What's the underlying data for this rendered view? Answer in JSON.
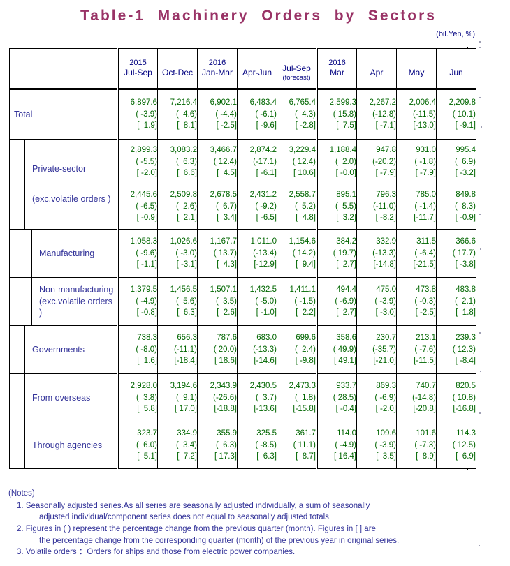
{
  "title": "Table-1  Machinery  Orders  by  Sectors",
  "unit_label": "(bil.Yen, %)",
  "header": {
    "label_col": "",
    "columns": [
      {
        "year": "2015",
        "period": "Jul-Sep",
        "note": ""
      },
      {
        "year": "",
        "period": "Oct-Dec",
        "note": ""
      },
      {
        "year": "2016",
        "period": "Jan-Mar",
        "note": ""
      },
      {
        "year": "",
        "period": "Apr-Jun",
        "note": ""
      },
      {
        "year": "",
        "period": "Jul-Sep",
        "note": "(forecast)"
      },
      {
        "year": "2016",
        "period": "Mar",
        "note": ""
      },
      {
        "year": "",
        "period": "Apr",
        "note": ""
      },
      {
        "year": "",
        "period": "May",
        "note": ""
      },
      {
        "year": "",
        "period": "Jun",
        "note": ""
      }
    ]
  },
  "colors": {
    "title": "#993366",
    "label_text": "#333399",
    "header_text": "#000080",
    "value_text": "#006600",
    "border": "#000000"
  },
  "rows": [
    {
      "label": "Total",
      "label2": "",
      "indent": 1,
      "values": [
        "6,897.6",
        "7,216.4",
        "6,902.1",
        "6,483.4",
        "6,765.4",
        "2,599.3",
        "2,267.2",
        "2,006.4",
        "2,209.8"
      ],
      "qoq": [
        "( -3.9)",
        "(  4.6)",
        "( -4.4)",
        "( -6.1)",
        "(  4.3)",
        "( 15.8)",
        "(-12.8)",
        "(-11.5)",
        "( 10.1)"
      ],
      "yoy": [
        "[  1.9]",
        "[  8.1]",
        "[ -2.5]",
        "[ -9.6]",
        "[ -2.8]",
        "[  7.5]",
        "[ -7.1]",
        "[-13.0]",
        "[ -9.1]"
      ]
    },
    {
      "label": "Private-sector",
      "label2": "(exc.volatile orders )",
      "indent": 2,
      "values": [
        "2,899.3",
        "3,083.2",
        "3,466.7",
        "2,874.2",
        "3,229.4",
        "1,188.4",
        "947.8",
        "931.0",
        "995.4"
      ],
      "qoq": [
        "( -5.5)",
        "(  6.3)",
        "( 12.4)",
        "(-17.1)",
        "( 12.4)",
        "(  2.0)",
        "(-20.2)",
        "( -1.8)",
        "(  6.9)"
      ],
      "yoy": [
        "[ -2.0]",
        "[  6.6]",
        "[  4.5]",
        "[ -6.1]",
        "[ 10.6]",
        "[ -0.0]",
        "[ -7.9]",
        "[ -7.9]",
        "[ -3.2]"
      ],
      "values2": [
        "2,445.6",
        "2,509.8",
        "2,678.5",
        "2,431.2",
        "2,558.7",
        "895.1",
        "796.3",
        "785.0",
        "849.8"
      ],
      "qoq2": [
        "( -6.5)",
        "(  2.6)",
        "(  6.7)",
        "( -9.2)",
        "(  5.2)",
        "(  5.5)",
        "(-11.0)",
        "( -1.4)",
        "(  8.3)"
      ],
      "yoy2": [
        "[ -0.9]",
        "[  2.1]",
        "[  3.4]",
        "[ -6.5]",
        "[  4.8]",
        "[  3.2]",
        "[ -8.2]",
        "[-11.7]",
        "[ -0.9]"
      ]
    },
    {
      "label": "Manufacturing",
      "label2": "",
      "indent": 3,
      "values": [
        "1,058.3",
        "1,026.6",
        "1,167.7",
        "1,011.0",
        "1,154.6",
        "384.2",
        "332.9",
        "311.5",
        "366.6"
      ],
      "qoq": [
        "( -9.6)",
        "( -3.0)",
        "( 13.7)",
        "(-13.4)",
        "( 14.2)",
        "( 19.7)",
        "(-13.3)",
        "( -6.4)",
        "( 17.7)"
      ],
      "yoy": [
        "[ -1.1]",
        "[ -3.1]",
        "[  4.3]",
        "[-12.9]",
        "[  9.4]",
        "[  2.7]",
        "[-14.8]",
        "[-21.5]",
        "[ -3.8]"
      ]
    },
    {
      "label": "Non-manufacturing",
      "label2": "(exc.volatile orders )",
      "indent": 3,
      "values": [
        "1,379.5",
        "1,456.5",
        "1,507.1",
        "1,432.5",
        "1,411.1",
        "494.4",
        "475.0",
        "473.8",
        "483.8"
      ],
      "qoq": [
        "( -4.9)",
        "(  5.6)",
        "(  3.5)",
        "( -5.0)",
        "( -1.5)",
        "( -6.9)",
        "( -3.9)",
        "( -0.3)",
        "(  2.1)"
      ],
      "yoy": [
        "[ -0.8]",
        "[  6.3]",
        "[  2.6]",
        "[ -1.0]",
        "[  2.2]",
        "[  2.7]",
        "[ -3.0]",
        "[ -2.5]",
        "[  1.8]"
      ]
    },
    {
      "label": "Governments",
      "label2": "",
      "indent": 2,
      "values": [
        "738.3",
        "656.3",
        "787.6",
        "683.0",
        "699.6",
        "358.6",
        "230.7",
        "213.1",
        "239.3"
      ],
      "qoq": [
        "( -8.0)",
        "(-11.1)",
        "( 20.0)",
        "(-13.3)",
        "(  2.4)",
        "( 49.9)",
        "(-35.7)",
        "( -7.6)",
        "( 12.3)"
      ],
      "yoy": [
        "[  1.6]",
        "[-18.4]",
        "[ 18.6]",
        "[-14.6]",
        "[ -9.8]",
        "[ 49.1]",
        "[-21.0]",
        "[-11.5]",
        "[ -8.4]"
      ]
    },
    {
      "label": "From overseas",
      "label2": "",
      "indent": 2,
      "values": [
        "2,928.0",
        "3,194.6",
        "2,343.9",
        "2,430.5",
        "2,473.3",
        "933.7",
        "869.3",
        "740.7",
        "820.5"
      ],
      "qoq": [
        "(  3.8)",
        "(  9.1)",
        "(-26.6)",
        "(  3.7)",
        "(  1.8)",
        "( 28.5)",
        "( -6.9)",
        "(-14.8)",
        "( 10.8)"
      ],
      "yoy": [
        "[  5.8]",
        "[ 17.0]",
        "[-18.8]",
        "[-13.6]",
        "[-15.8]",
        "[ -0.4]",
        "[ -2.0]",
        "[-20.8]",
        "[-16.8]"
      ]
    },
    {
      "label": "Through agencies",
      "label2": "",
      "indent": 2,
      "values": [
        "323.7",
        "334.9",
        "355.9",
        "325.5",
        "361.7",
        "114.0",
        "109.6",
        "101.6",
        "114.3"
      ],
      "qoq": [
        "(  6.0)",
        "(  3.4)",
        "(  6.3)",
        "( -8.5)",
        "( 11.1)",
        "( -4.9)",
        "( -3.9)",
        "( -7.3)",
        "( 12.5)"
      ],
      "yoy": [
        "[  5.1]",
        "[  7.2]",
        "[ 17.3]",
        "[  6.3]",
        "[  8.7]",
        "[ 16.4]",
        "[  3.5]",
        "[  8.9]",
        "[  6.9]"
      ]
    }
  ],
  "notes": {
    "header": "(Notes)",
    "items": [
      {
        "num": "1.",
        "line1": "Seasonally adjusted series.As all series are seasonally adjusted individually, a sum of seasonally",
        "line2": "adjusted individual/component series does not equal to seasonally adjusted totals."
      },
      {
        "num": "2.",
        "line1": "Figures in ( ) represent the percentage change from the previous quarter (month). Figures in [ ] are",
        "line2": "the percentage change from the corresponding quarter (month) of the previous year in original series."
      },
      {
        "num": "3.",
        "line1": "Volatile orders ：Orders for ships and those from electric power companies.",
        "line2": ""
      }
    ]
  }
}
